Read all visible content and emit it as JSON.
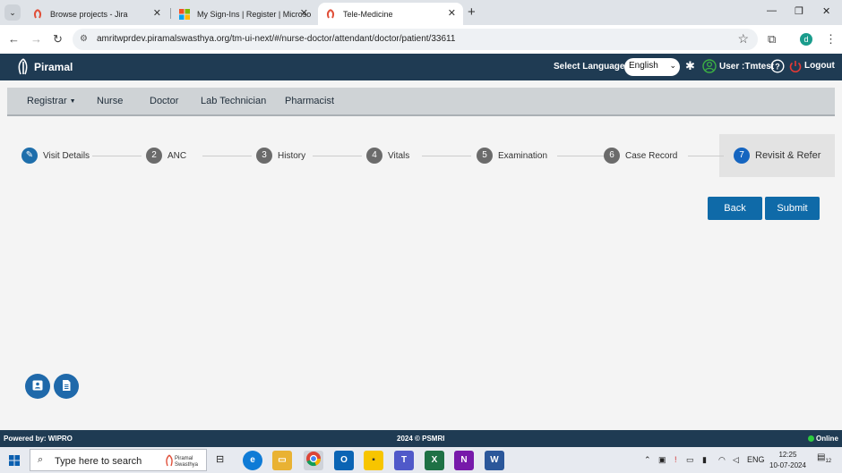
{
  "browser": {
    "tabs": [
      {
        "title": "Browse projects - Jira",
        "icon": "jira-favicon"
      },
      {
        "title": "My Sign-Ins | Register | Microso",
        "icon": "microsoft-favicon"
      },
      {
        "title": "Tele-Medicine",
        "icon": "piramal-favicon"
      }
    ],
    "url": "amritwprdev.piramalswasthya.org/tm-ui-next/#/nurse-doctor/attendant/doctor/patient/33611",
    "profile_initial": "d"
  },
  "header": {
    "brand": "Piramal",
    "language_label": "Select Language:",
    "language_value": "English",
    "user_label": "User :Tmtest",
    "logout_label": "Logout"
  },
  "roles": [
    {
      "label": "Registrar"
    },
    {
      "label": "Nurse"
    },
    {
      "label": "Doctor"
    },
    {
      "label": "Lab Technician"
    },
    {
      "label": "Pharmacist"
    }
  ],
  "steps": [
    {
      "num": "",
      "label": "Visit Details"
    },
    {
      "num": "2",
      "label": "ANC"
    },
    {
      "num": "3",
      "label": "History"
    },
    {
      "num": "4",
      "label": "Vitals"
    },
    {
      "num": "5",
      "label": "Examination"
    },
    {
      "num": "6",
      "label": "Case Record"
    },
    {
      "num": "7",
      "label": "Revisit & Refer"
    }
  ],
  "actions": {
    "back": "Back",
    "submit": "Submit"
  },
  "footer": {
    "left": "Powered by: WIPRO",
    "mid": "2024 © PSMRI",
    "status": "Online"
  },
  "taskbar": {
    "search_placeholder": "Type here to search",
    "search_badge": "Piramal Swasthya",
    "lang": "ENG",
    "time": "12:25",
    "date": "10-07-2024",
    "notifications": "12"
  }
}
